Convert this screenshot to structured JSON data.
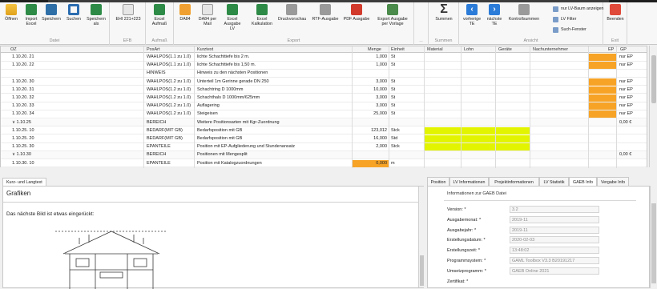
{
  "ribbon": {
    "groups": [
      {
        "label": "Datei"
      },
      {
        "label": "EFB"
      },
      {
        "label": "Aufmaß"
      },
      {
        "label": "Export"
      },
      {
        "label": "..."
      },
      {
        "label": "Summen"
      },
      {
        "label": "Ansicht"
      },
      {
        "label": "Exit"
      }
    ],
    "buttons": [
      {
        "label": "Öffnen",
        "icon": "open-folder-icon"
      },
      {
        "label": "Import Excel",
        "icon": "excel-import-icon"
      },
      {
        "label": "Speichern",
        "icon": "save-icon"
      },
      {
        "label": "Suchen",
        "icon": "search-icon"
      },
      {
        "label": "Speichern als",
        "icon": "save-as-icon"
      },
      {
        "label": "EHI 221+223",
        "icon": "efb-icon"
      },
      {
        "label": "Excel Aufmaß",
        "icon": "excel-icon"
      },
      {
        "label": "DA84",
        "icon": "da84-icon"
      },
      {
        "label": "DA84 per Mail",
        "icon": "mail-icon"
      },
      {
        "label": "Excel Ausgabe LV",
        "icon": "excel-icon"
      },
      {
        "label": "Excel Kalkulation",
        "icon": "excel-icon"
      },
      {
        "label": "Druckvorschau",
        "icon": "print-preview-icon"
      },
      {
        "label": "RTF-Ausgabe",
        "icon": "rtf-icon"
      },
      {
        "label": "PDF Ausgabe",
        "icon": "pdf-icon"
      },
      {
        "label": "Export Ausgabe per Vorlage",
        "icon": "export-template-icon"
      },
      {
        "label": "Summen",
        "icon": "sigma-icon"
      },
      {
        "label": "vorherige TE",
        "icon": "arrow-left-icon"
      },
      {
        "label": "nächste TE",
        "icon": "arrow-right-icon"
      },
      {
        "label": "Kontrollsummen",
        "icon": "checksum-icon"
      },
      {
        "label": "Beenden",
        "icon": "exit-icon"
      }
    ],
    "view_toggles": [
      "nur LV-Baum anzeigen",
      "LV Filter",
      "Such-Fenster"
    ]
  },
  "grid": {
    "headers": {
      "oz": "OZ",
      "posart": "PosArt",
      "kurztext": "Kurztext",
      "menge": "Menge",
      "einheit": "Einheit",
      "material": "Material",
      "lohn": "Lohn",
      "geraete": "Geräte",
      "nu": "Nachunternehmer",
      "ep": "EP",
      "gp": "GP"
    },
    "rows": [
      {
        "oz": "1.10.20.  21",
        "posart": "WAHLPOS(1.1 zu 1.0)",
        "kurztext": "lichte Schachttiefe bis 2 m.",
        "menge": "1,000",
        "einheit": "St",
        "gp": "nur EP"
      },
      {
        "oz": "1.10.20.  22",
        "posart": "WAHLPOS(1.1 zu 1.0)",
        "kurztext": "lichte Schachttiefe bis 1,50 m.",
        "menge": "1,000",
        "einheit": "St",
        "gp": "nur EP"
      },
      {
        "oz": "",
        "posart": "HINWEIS",
        "kurztext": "Hinweis zu den nächsten Positionen",
        "menge": "",
        "einheit": "",
        "gp": ""
      },
      {
        "oz": "1.10.20.  30",
        "posart": "WAHLPOS(1.2 zu 1.0)",
        "kurztext": "Unterteil 1m Gerinne gerade DN 250",
        "menge": "3,000",
        "einheit": "St",
        "gp": "nur EP"
      },
      {
        "oz": "1.10.20.  31",
        "posart": "WAHLPOS(1.2 zu 1.0)",
        "kurztext": "Schachtring D 1000mm",
        "menge": "10,000",
        "einheit": "St",
        "gp": "nur EP"
      },
      {
        "oz": "1.10.20.  32",
        "posart": "WAHLPOS(1.2 zu 1.0)",
        "kurztext": "Schachthals D 1000mm/625mm",
        "menge": "3,000",
        "einheit": "St",
        "gp": "nur EP"
      },
      {
        "oz": "1.10.20.  33",
        "posart": "WAHLPOS(1.2 zu 1.0)",
        "kurztext": "Auflagering",
        "menge": "3,000",
        "einheit": "St",
        "gp": "nur EP"
      },
      {
        "oz": "1.10.20.  34",
        "posart": "WAHLPOS(1.2 zu 1.0)",
        "kurztext": "Steigeisen",
        "menge": "25,000",
        "einheit": "St",
        "gp": "nur EP"
      },
      {
        "oz": "∨  1.10.25",
        "posart": "BEREICH",
        "kurztext": "Weitere Positionsarten mit Kgr-Zuordnung",
        "menge": "",
        "einheit": "",
        "gp": "0,00 €"
      },
      {
        "oz": "1.10.25.  10",
        "posart": "BEDARF(MIT GB)",
        "kurztext": "Bedarfsposition mit GB",
        "menge": "123,012",
        "einheit": "Stck",
        "gp": ""
      },
      {
        "oz": "1.10.25.  20",
        "posart": "BEDARF(MIT GB)",
        "kurztext": "Bedarfsposition mit GB",
        "menge": "16,000",
        "einheit": "Std",
        "gp": ""
      },
      {
        "oz": "1.10.25.  30",
        "posart": "EPANTEILE",
        "kurztext": "Position mit EP-Aufgliederung und Stundenansatz",
        "menge": "2,000",
        "einheit": "Stck",
        "gp": ""
      },
      {
        "oz": "∨  1.10.30",
        "posart": "BEREICH",
        "kurztext": "Positionen mit Mengesplit",
        "menge": "",
        "einheit": "",
        "gp": "0,00 €"
      },
      {
        "oz": "1.10.30.  10",
        "posart": "EPANTEILE",
        "kurztext": "Position mit Katalogzuordnungen",
        "menge": "0,000",
        "einheit": "m",
        "gp": ""
      }
    ]
  },
  "bottom_left": {
    "tab": "Kurz- und Langtext",
    "title": "Grafiken",
    "text": "Das nächste Bild ist etwas eingerückt:"
  },
  "right_panel": {
    "tabs": [
      "Position",
      "LV Informationen",
      "Projektinformationen",
      "LV Statistik",
      "GAEB Info",
      "Vergabe Info"
    ],
    "active_tab": "GAEB Info",
    "title": "Informationen zur GAEB Datei",
    "fields": [
      {
        "label": "Version: *",
        "value": "3.2"
      },
      {
        "label": "Ausgabemonat: *",
        "value": "2019-11"
      },
      {
        "label": "Ausgabejahr: *",
        "value": "2019-11"
      },
      {
        "label": "Erstellungsdatum: *",
        "value": "2020-02-03"
      },
      {
        "label": "Erstellungszeit: *",
        "value": "13:48:02"
      },
      {
        "label": "Programmsystem: *",
        "value": "GAML Toolbox V3.3 B20191217"
      },
      {
        "label": "Umsetzprogramm: *",
        "value": "GAEB Online 2021"
      },
      {
        "label": "Zertifikat: *",
        "value": ""
      }
    ]
  }
}
